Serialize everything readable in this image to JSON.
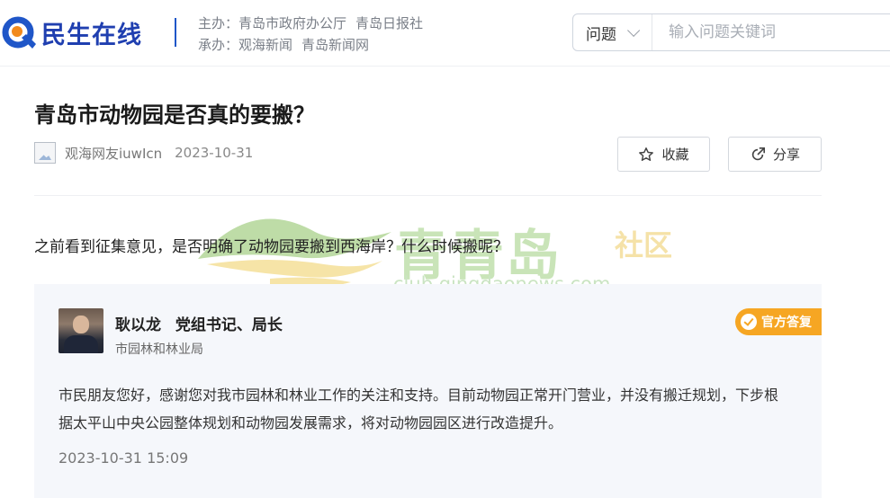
{
  "header": {
    "logo_text": "民生在线",
    "sponsor_label": "主办：",
    "sponsors": [
      "青岛市政府办公厅",
      "青岛日报社"
    ],
    "organizer_label": "承办：",
    "organizers": [
      "观海新闻",
      "青岛新闻网"
    ],
    "search": {
      "category": "问题",
      "placeholder": "输入问题关键词"
    }
  },
  "post": {
    "title": "青岛市动物园是否真的要搬？",
    "author": "观海网友iuwIcn",
    "date": "2023-10-31",
    "favorite_label": "收藏",
    "share_label": "分享",
    "question": "之前看到征集意见，是否明确了动物园要搬到西海岸？什么时候搬呢？"
  },
  "watermark": {
    "name": "青青岛",
    "suffix": "社区",
    "url": "club.qingdaonews.com"
  },
  "answer": {
    "name": "耿以龙",
    "title": "党组书记、局长",
    "department": "市园林和林业局",
    "badge": "官方答复",
    "text": "市民朋友您好，感谢您对我市园林和林业工作的关注和支持。目前动物园正常开门营业，并没有搬迁规划，下步根据太平山中央公园整体规划和动物园发展需求，将对动物园园区进行改造提升。",
    "time": "2023-10-31 15:09"
  },
  "colors": {
    "brand_blue": "#1f3fb0",
    "badge_orange": "#f6a623",
    "answer_bg": "#f5f7fb"
  }
}
